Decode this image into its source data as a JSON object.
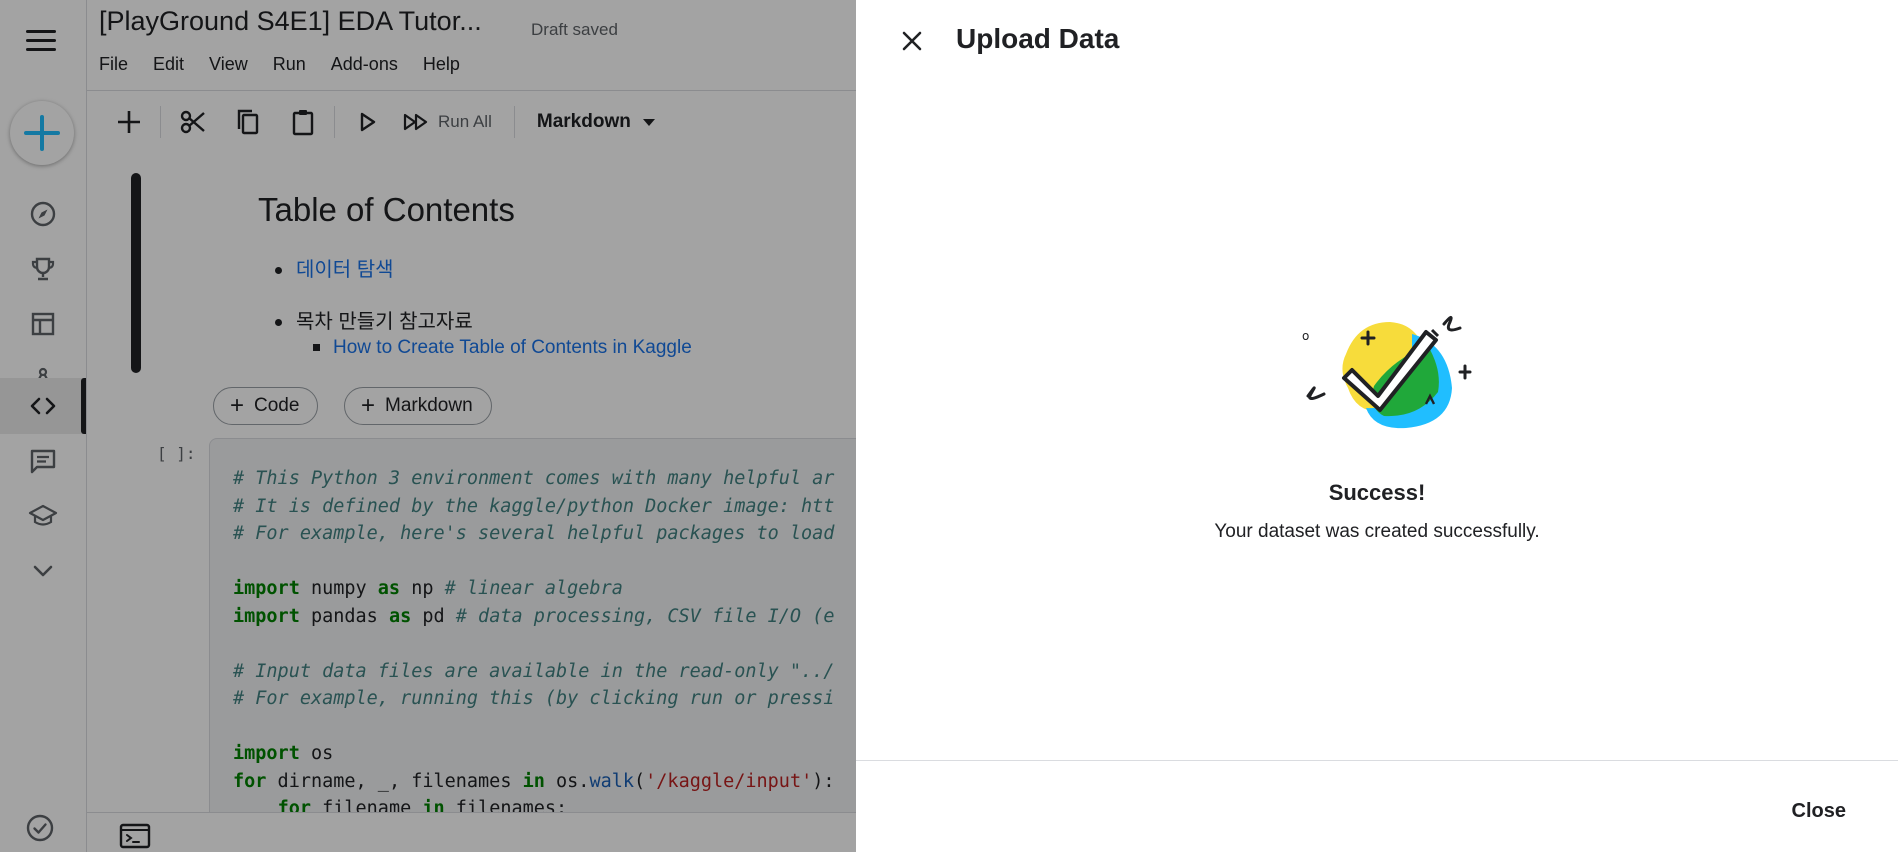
{
  "notebook": {
    "title": "[PlayGround S4E1] EDA Tutor...",
    "status": "Draft saved",
    "menu": [
      "File",
      "Edit",
      "View",
      "Run",
      "Add-ons",
      "Help"
    ],
    "toolbar": {
      "run_all": "Run All",
      "cell_type": "Markdown"
    },
    "toc": {
      "title": "Table of Contents",
      "items": [
        {
          "text": "데이터 탐색",
          "is_link": true
        },
        {
          "text": "목차 만들기 참고자료",
          "is_link": false
        },
        {
          "text": "How to Create Table of Contents in Kaggle",
          "is_link": true
        }
      ]
    },
    "add_code_label": "Code",
    "add_markdown_label": "Markdown",
    "code_prompt": "[ ]:",
    "code_lines": [
      "# This Python 3 environment comes with many helpful ar",
      "# It is defined by the kaggle/python Docker image: htt",
      "# For example, here's several helpful packages to load",
      "",
      "import numpy as np # linear algebra",
      "import pandas as pd # data processing, CSV file I/O (e",
      "",
      "# Input data files are available in the read-only \"../",
      "# For example, running this (by clicking run or pressi",
      "",
      "import os",
      "for dirname, _, filenames in os.walk('/kaggle/input'):",
      "    for filename in filenames:"
    ]
  },
  "rail": {
    "items": [
      "compass-icon",
      "trophy-icon",
      "table-icon",
      "models-icon",
      "code-icon",
      "discussion-icon",
      "learn-icon",
      "chevron-down-icon"
    ],
    "active": "code-icon"
  },
  "panel": {
    "title": "Upload Data",
    "success_title": "Success!",
    "success_message": "Your dataset was created successfully.",
    "close_label": "Close"
  },
  "colors": {
    "accent_blue": "#20beff",
    "yellow": "#f7dc3b",
    "green": "#20a83a",
    "scrim": "rgba(0,0,0,0.36)"
  }
}
